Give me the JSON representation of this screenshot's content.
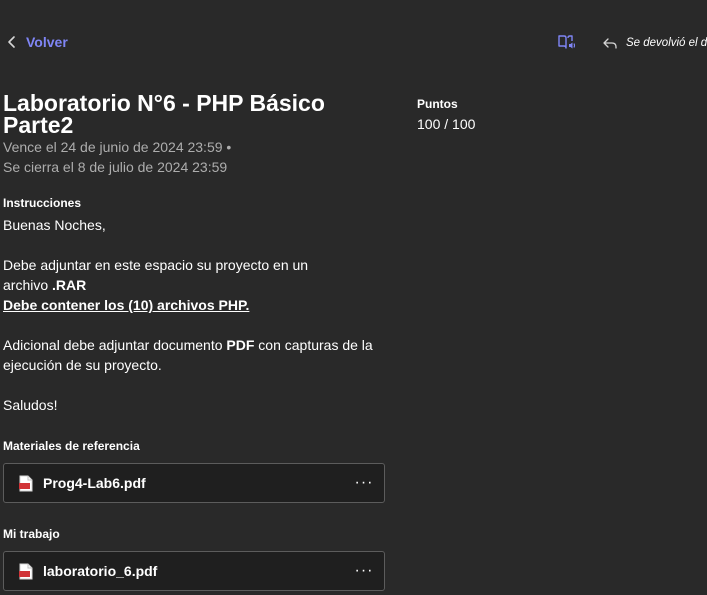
{
  "nav": {
    "back_label": "Volver"
  },
  "header": {
    "returned_text": "Se devolvió el d"
  },
  "assignment": {
    "title": "Laboratorio N°6 - PHP Básico Parte2",
    "due_line": "Vence el 24 de junio de 2024 23:59 •",
    "close_line": "Se cierra el 8 de julio de 2024 23:59"
  },
  "points": {
    "label": "Puntos",
    "value": "100 / 100"
  },
  "instructions": {
    "label": "Instrucciones",
    "greeting": "Buenas Noches,",
    "line1": "Debe adjuntar en este espacio su proyecto en un",
    "line2_prefix": "archivo ",
    "line2_bold": ".RAR",
    "line3": "Debe contener los (10) archivos PHP.",
    "line4_prefix": "Adicional debe adjuntar documento ",
    "line4_bold": "PDF",
    "line4_suffix": " con capturas de la ejecución de su proyecto.",
    "closing": "Saludos!"
  },
  "reference": {
    "label": "Materiales de referencia",
    "file": "Prog4-Lab6.pdf",
    "more": "···"
  },
  "my_work": {
    "label": "Mi trabajo",
    "file": "laboratorio_6.pdf",
    "more": "···"
  },
  "colors": {
    "background": "#292929",
    "accent": "#7f85f5",
    "muted_text": "#adadad",
    "card_border": "#5c5c5c",
    "pdf_red": "#d13438"
  },
  "icons": [
    "chevron-left-icon",
    "immersive-reader-icon",
    "reply-arrow-icon",
    "pdf-file-icon"
  ]
}
